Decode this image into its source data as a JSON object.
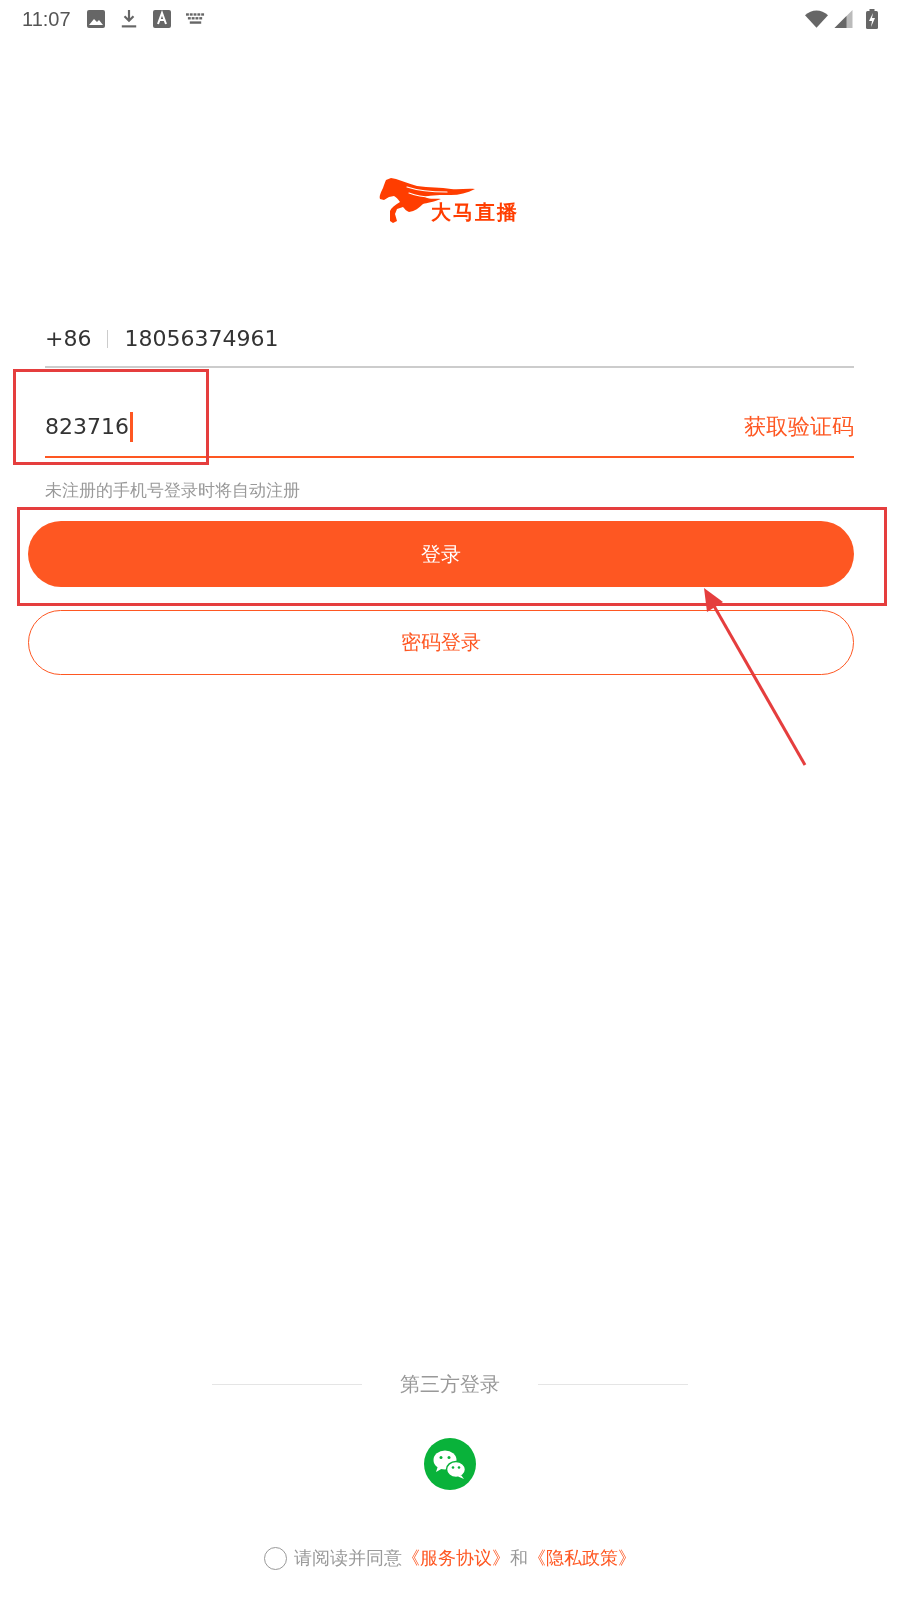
{
  "status_bar": {
    "time": "11:07"
  },
  "logo": {
    "text": "大马直播"
  },
  "phone_field": {
    "country_code": "+86",
    "value": "18056374961"
  },
  "code_field": {
    "value": "823716",
    "focused": true,
    "highlighted": true,
    "get_code_button": "获取验证码"
  },
  "hint": "未注册的手机号登录时将自动注册",
  "login_button": {
    "label": "登录",
    "highlighted": true,
    "pointed_at": true
  },
  "password_login_button": {
    "label": "密码登录"
  },
  "third_party": {
    "title": "第三方登录",
    "providers": [
      {
        "kind": "wechat"
      }
    ]
  },
  "agreement": {
    "checked": false,
    "parts": [
      {
        "kind": "text",
        "text": "请阅读并同意"
      },
      {
        "kind": "link",
        "text": "《服务协议》"
      },
      {
        "kind": "text",
        "text": "和"
      },
      {
        "kind": "link",
        "text": "《隐私政策》"
      }
    ]
  }
}
